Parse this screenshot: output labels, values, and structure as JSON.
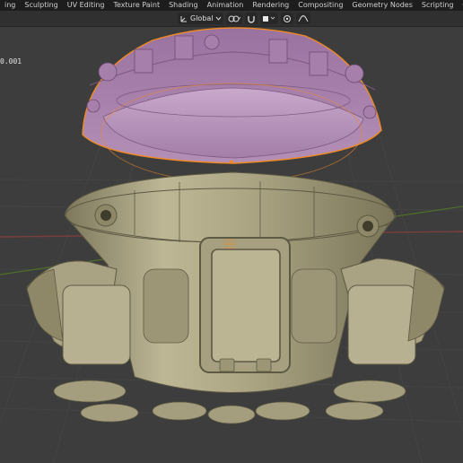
{
  "workspace_tabs": [
    {
      "label": "ing",
      "active": false
    },
    {
      "label": "Sculpting",
      "active": false
    },
    {
      "label": "UV Editing",
      "active": false
    },
    {
      "label": "Texture Paint",
      "active": false
    },
    {
      "label": "Shading",
      "active": false
    },
    {
      "label": "Animation",
      "active": false
    },
    {
      "label": "Rendering",
      "active": false
    },
    {
      "label": "Compositing",
      "active": false
    },
    {
      "label": "Geometry Nodes",
      "active": false
    },
    {
      "label": "Scripting",
      "active": false
    }
  ],
  "add_workspace_label": "+",
  "viewport_header": {
    "transform_orientation": "Global",
    "snapping_enabled": false,
    "proportional_editing_enabled": false
  },
  "viewport": {
    "coordinate_readout": "0.001",
    "colors": {
      "background": "#3d3d3d",
      "model_base": "#b5af8f",
      "model_shade": "#8e8868",
      "selected_mesh": "#a27ba6",
      "selection_outline": "#f08a24",
      "grid_x_axis": "#7a3e3e",
      "grid_y_axis": "#4f6e2a"
    }
  }
}
